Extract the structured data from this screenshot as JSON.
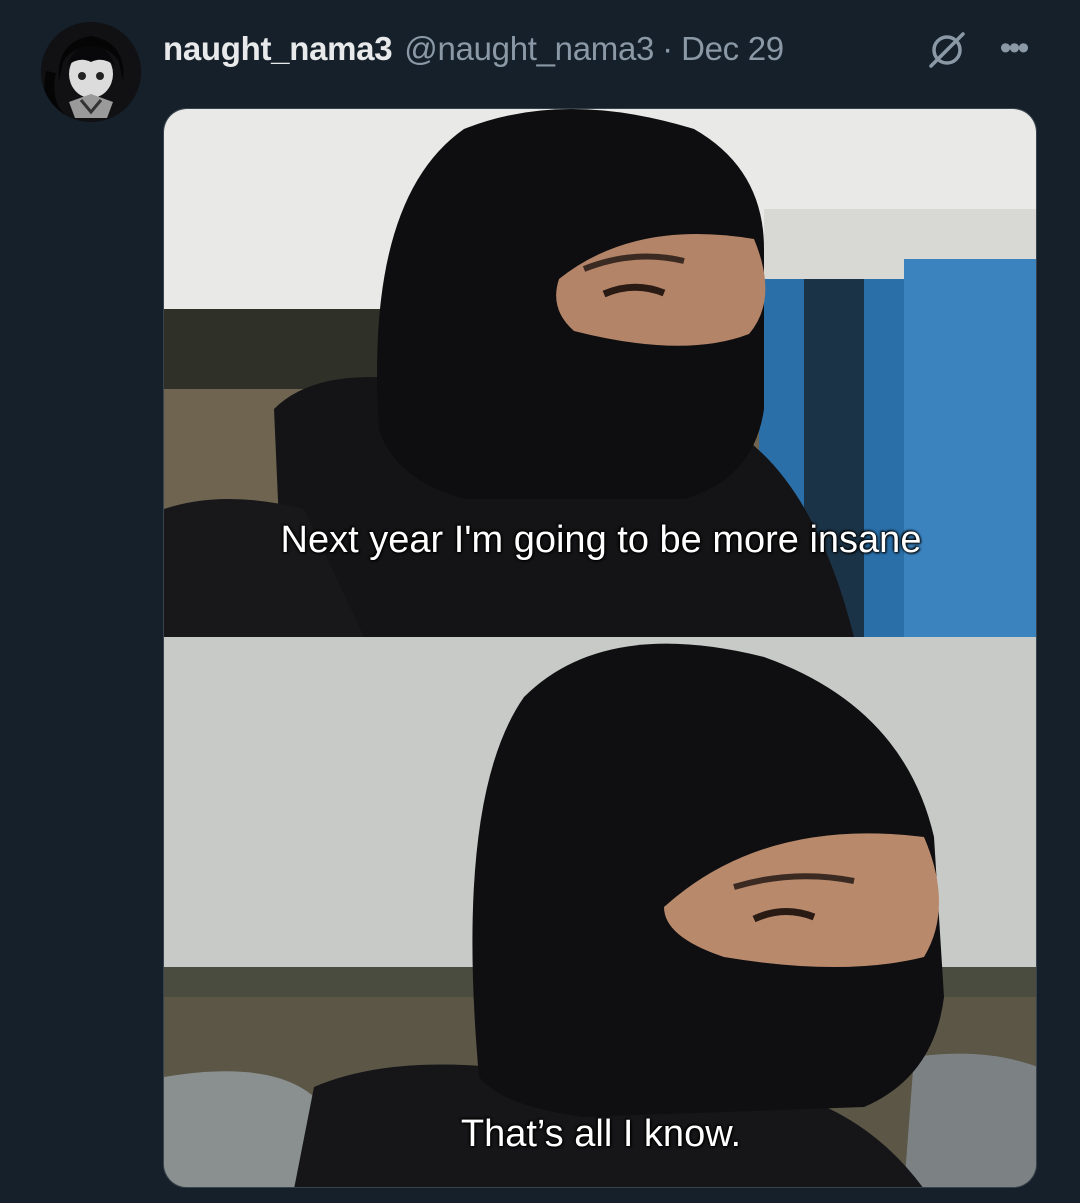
{
  "tweet": {
    "display_name": "naught_nama3",
    "handle": "@naught_nama3",
    "separator": "·",
    "date": "Dec 29",
    "more_label": "•••"
  },
  "icons": {
    "grok": "slashed-circle-icon",
    "more": "more-dots-icon",
    "avatar": "anime-character-avatar"
  },
  "meme": {
    "top_caption": "Next year I'm going to be more insane",
    "bottom_caption": "That’s all I know."
  },
  "colors": {
    "background": "#15202b",
    "primary_text": "#e7e9ea",
    "secondary_text": "#8b98a5"
  }
}
